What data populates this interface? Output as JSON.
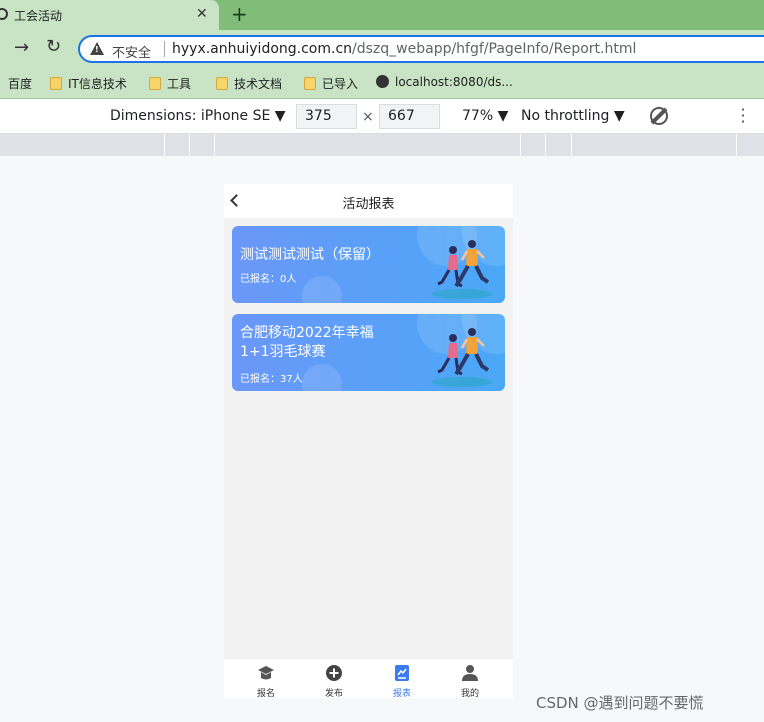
{
  "browser": {
    "tab_title": "工会活动",
    "tab_close": "✕",
    "new_tab": "+",
    "insecure_label": "不安全",
    "url_host": "hyyx.anhuiyidong.com.cn",
    "url_path": "/dszq_webapp/hfgf/PageInfo/Report.html",
    "bookmarks": [
      "百度",
      "IT信息技术",
      "工具",
      "技术文档",
      "已导入",
      "localhost:8080/ds..."
    ]
  },
  "devtools": {
    "dimensions_label": "Dimensions: iPhone SE ▼",
    "width": "375",
    "height": "667",
    "times": "×",
    "zoom": "77% ▼",
    "throttling": "No throttling ▼"
  },
  "app": {
    "title": "活动报表",
    "cards": [
      {
        "title": "测试测试测试（保留）",
        "signup": "已报名：0人"
      },
      {
        "title": "合肥移动2022年幸福1+1羽毛球赛",
        "signup": "已报名：37人"
      }
    ],
    "tabs": [
      {
        "label": "报名"
      },
      {
        "label": "发布"
      },
      {
        "label": "报表"
      },
      {
        "label": "我的"
      }
    ],
    "active_tab": "报表"
  },
  "watermark": "CSDN @遇到问题不要慌",
  "colors": {
    "accent": "#3a7bf0",
    "card_gradient_start": "#6b97f9",
    "card_gradient_end": "#4aa8f7",
    "chrome_green": "#c9e4c4"
  }
}
